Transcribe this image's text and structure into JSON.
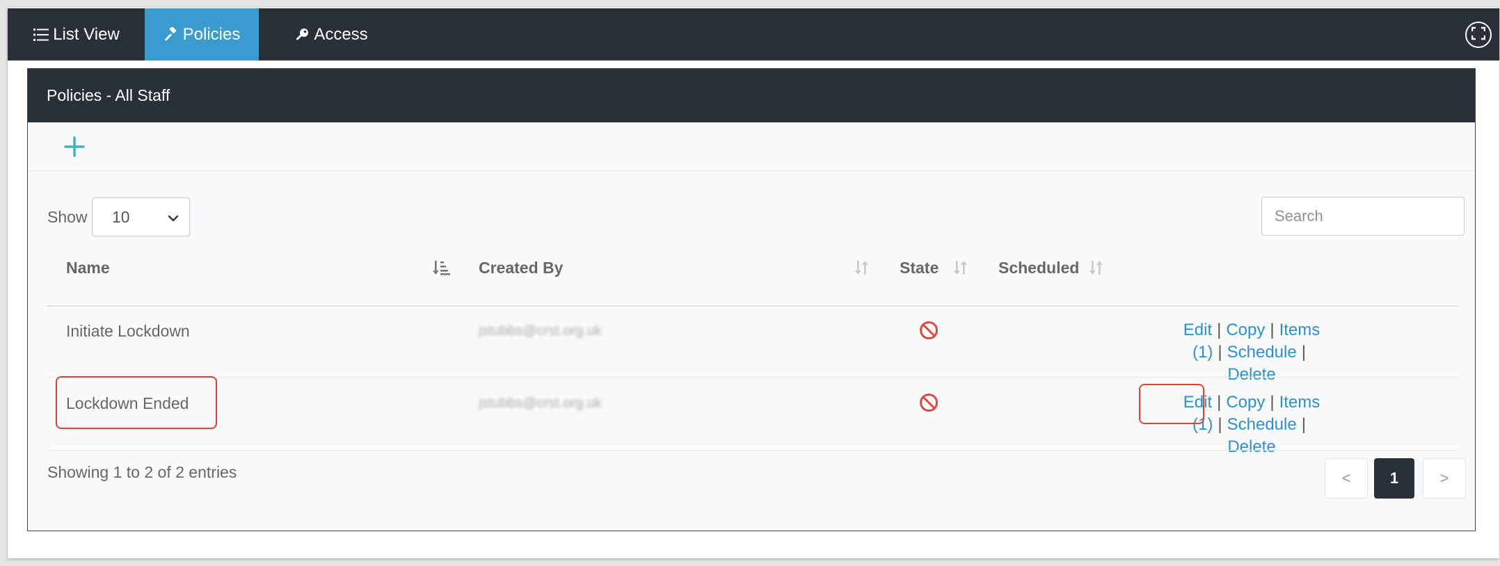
{
  "tabs": [
    {
      "label": "List View",
      "icon": "list-icon"
    },
    {
      "label": "Policies",
      "icon": "gavel-icon",
      "active": true
    },
    {
      "label": "Access",
      "icon": "key-icon"
    }
  ],
  "panel": {
    "title": "Policies - All Staff"
  },
  "table_controls": {
    "show_label": "Show",
    "page_size": "10",
    "search_placeholder": "Search"
  },
  "columns": [
    "Name",
    "Created By",
    "State",
    "Scheduled"
  ],
  "rows": [
    {
      "name": "Initiate Lockdown",
      "created_by": "jstubbs@crst.org.uk",
      "state": "disabled"
    },
    {
      "name": "Lockdown Ended",
      "created_by": "jstubbs@crst.org.uk",
      "state": "disabled"
    }
  ],
  "actions": {
    "edit": "Edit",
    "copy": "Copy",
    "items": "Items (1)",
    "schedule": "Schedule",
    "delete": "Delete",
    "separator": "|"
  },
  "footer": {
    "info": "Showing 1 to 2 of 2 entries",
    "prev": "<",
    "current_page": "1",
    "next": ">"
  },
  "colors": {
    "header_bg": "#2a3038",
    "active_tab": "#3a9bcf",
    "link": "#2e8fc9",
    "add_button": "#3bb3c3",
    "state_disabled": "#e0473c",
    "highlight": "#d9432f"
  }
}
